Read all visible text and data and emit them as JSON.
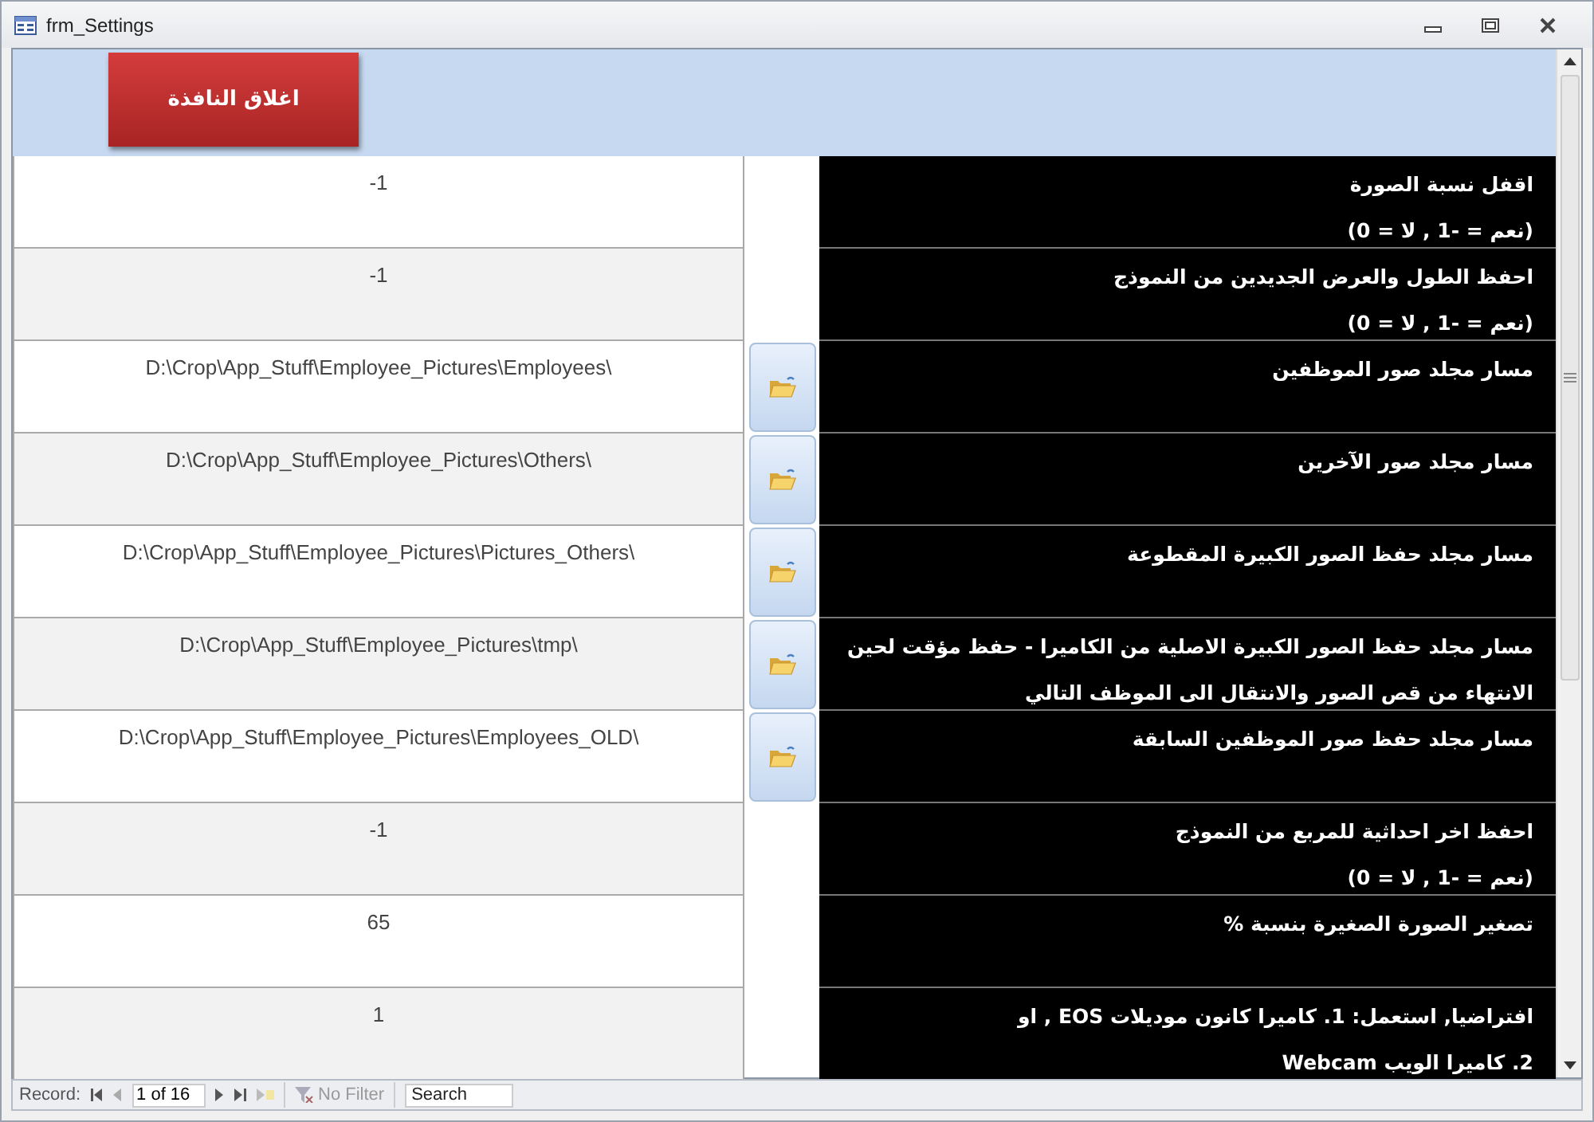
{
  "window": {
    "title": "frm_Settings"
  },
  "close_button": {
    "label": "اغلاق النافذة"
  },
  "rows": [
    {
      "kind": "plain",
      "value": "-1",
      "label": "اقفل نسبة الصورة",
      "note": "(نعم = -1  ,  لا = 0)"
    },
    {
      "kind": "plain",
      "value": "-1",
      "label": "احفظ الطول والعرض الجديدين من النموذج",
      "note": "(نعم = -1  ,  لا = 0)"
    },
    {
      "kind": "browse",
      "value": "D:\\Crop\\App_Stuff\\Employee_Pictures\\Employees\\",
      "label": "مسار مجلد صور الموظفين"
    },
    {
      "kind": "browse",
      "value": "D:\\Crop\\App_Stuff\\Employee_Pictures\\Others\\",
      "label": "مسار مجلد صور الآخرين"
    },
    {
      "kind": "browse",
      "value": "D:\\Crop\\App_Stuff\\Employee_Pictures\\Pictures_Others\\",
      "label": "مسار مجلد حفظ الصور الكبيرة المقطوعة"
    },
    {
      "kind": "browse",
      "value": "D:\\Crop\\App_Stuff\\Employee_Pictures\\tmp\\",
      "label": "مسار مجلد حفظ الصور الكبيرة الاصلية من الكاميرا - حفظ مؤقت لحين الانتهاء من قص الصور والانتقال الى الموظف التالي"
    },
    {
      "kind": "browse",
      "value": "D:\\Crop\\App_Stuff\\Employee_Pictures\\Employees_OLD\\",
      "label": "مسار مجلد حفظ صور الموظفين السابقة"
    },
    {
      "kind": "plain",
      "value": "-1",
      "label": "احفظ اخر احداثية للمربع من النموذج",
      "note": "(نعم = -1  ,  لا = 0)"
    },
    {
      "kind": "plain",
      "value": "65",
      "label": "تصغير الصورة الصغيرة بنسبة %"
    },
    {
      "kind": "plain",
      "value": "1",
      "label": "افتراضيا, استعمل:  1. كاميرا كانون موديلات EOS , او",
      "note": "2. كاميرا الويب Webcam"
    }
  ],
  "navigation": {
    "record_label": "Record:",
    "position": "1 of 16",
    "filter": {
      "label": "No Filter",
      "disabled": true
    },
    "search": {
      "placeholder": "Search"
    }
  }
}
